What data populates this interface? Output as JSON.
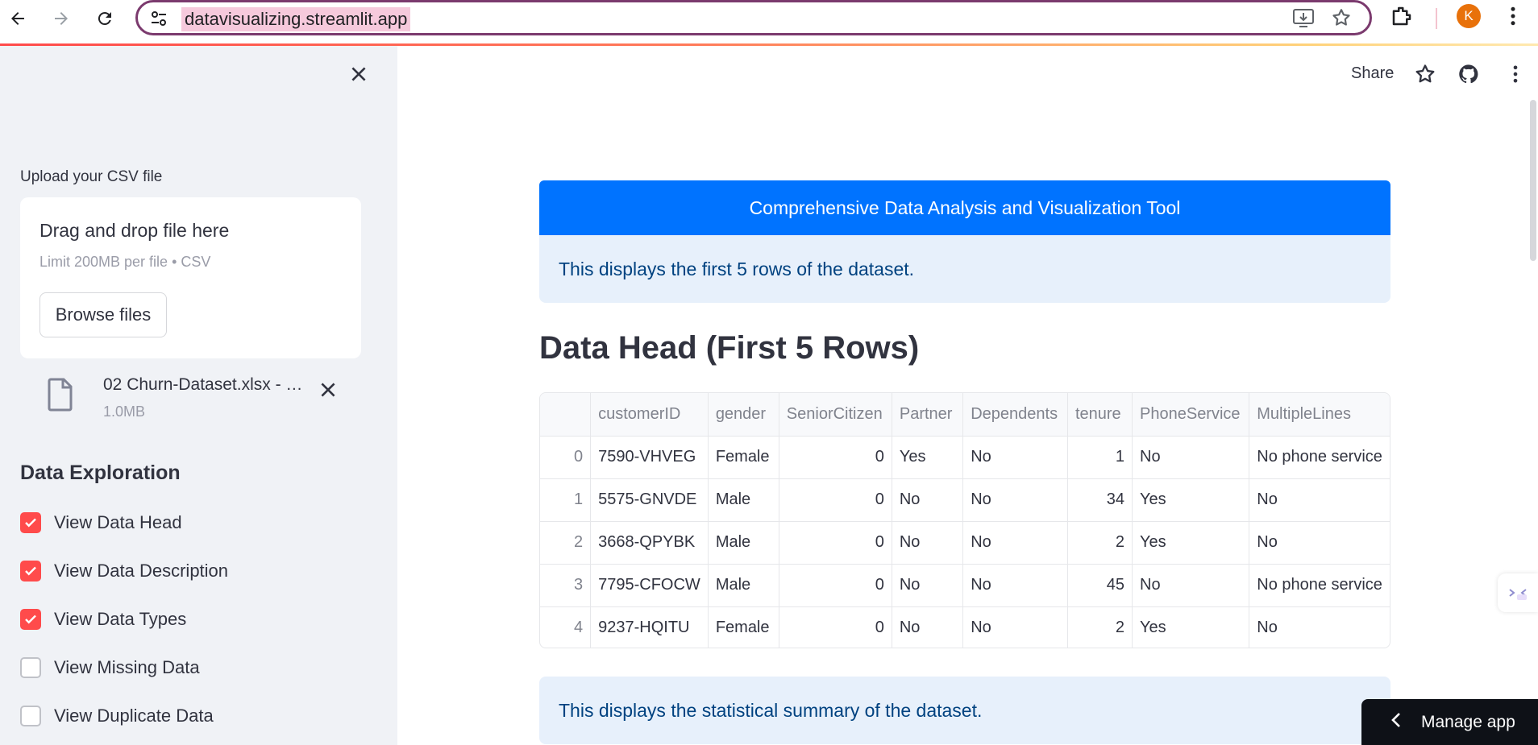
{
  "browser": {
    "url": "datavisualizing.streamlit.app",
    "avatar_letter": "K",
    "accent": "#7b3a6e"
  },
  "sidebar": {
    "upload_label": "Upload your CSV file",
    "dropzone_title": "Drag and drop file here",
    "dropzone_limit": "Limit 200MB per file • CSV",
    "browse_label": "Browse files",
    "file_name": "02 Churn-Dataset.xlsx - …",
    "file_size": "1.0MB",
    "section_title": "Data Exploration",
    "options": [
      {
        "label": "View Data Head",
        "checked": true
      },
      {
        "label": "View Data Description",
        "checked": true
      },
      {
        "label": "View Data Types",
        "checked": true
      },
      {
        "label": "View Missing Data",
        "checked": false
      },
      {
        "label": "View Duplicate Data",
        "checked": false
      }
    ]
  },
  "toolbar": {
    "share_label": "Share"
  },
  "main": {
    "banner": "Comprehensive Data Analysis and Visualization Tool",
    "info_head": "This displays the first 5 rows of the dataset.",
    "heading": "Data Head (First 5 Rows)",
    "info_summary": "This displays the statistical summary of the dataset.",
    "table": {
      "columns": [
        "",
        "customerID",
        "gender",
        "SeniorCitizen",
        "Partner",
        "Dependents",
        "tenure",
        "PhoneService",
        "MultipleLines"
      ],
      "rows": [
        [
          "0",
          "7590-VHVEG",
          "Female",
          "0",
          "Yes",
          "No",
          "1",
          "No",
          "No phone service"
        ],
        [
          "1",
          "5575-GNVDE",
          "Male",
          "0",
          "No",
          "No",
          "34",
          "Yes",
          "No"
        ],
        [
          "2",
          "3668-QPYBK",
          "Male",
          "0",
          "No",
          "No",
          "2",
          "Yes",
          "No"
        ],
        [
          "3",
          "7795-CFOCW",
          "Male",
          "0",
          "No",
          "No",
          "45",
          "No",
          "No phone service"
        ],
        [
          "4",
          "9237-HQITU",
          "Female",
          "0",
          "No",
          "No",
          "2",
          "Yes",
          "No"
        ]
      ]
    }
  },
  "manage_app_label": "Manage app",
  "colors": {
    "primary": "#0073ff",
    "checkbox": "#ff4b4b",
    "info_bg": "#e7f0fb",
    "sidebar_bg": "#f0f2f6"
  }
}
